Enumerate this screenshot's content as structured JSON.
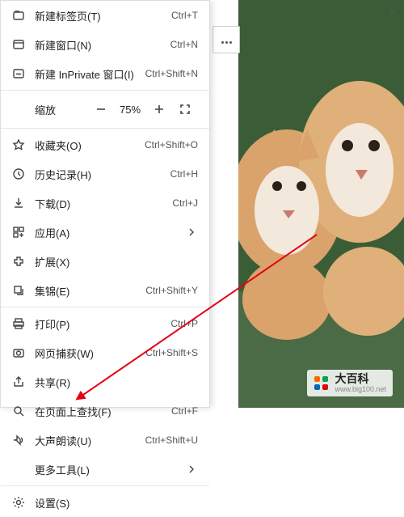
{
  "window": {
    "close": "✕"
  },
  "menu": {
    "new_tab": {
      "label": "新建标签页(T)",
      "shortcut": "Ctrl+T"
    },
    "new_window": {
      "label": "新建窗口(N)",
      "shortcut": "Ctrl+N"
    },
    "new_inprivate": {
      "label": "新建 InPrivate 窗口(I)",
      "shortcut": "Ctrl+Shift+N"
    },
    "zoom": {
      "label": "缩放",
      "value": "75%"
    },
    "favorites": {
      "label": "收藏夹(O)",
      "shortcut": "Ctrl+Shift+O"
    },
    "history": {
      "label": "历史记录(H)",
      "shortcut": "Ctrl+H"
    },
    "downloads": {
      "label": "下载(D)",
      "shortcut": "Ctrl+J"
    },
    "apps": {
      "label": "应用(A)"
    },
    "extensions": {
      "label": "扩展(X)"
    },
    "collections": {
      "label": "集锦(E)",
      "shortcut": "Ctrl+Shift+Y"
    },
    "print": {
      "label": "打印(P)",
      "shortcut": "Ctrl+P"
    },
    "capture": {
      "label": "网页捕获(W)",
      "shortcut": "Ctrl+Shift+S"
    },
    "share": {
      "label": "共享(R)"
    },
    "find": {
      "label": "在页面上查找(F)",
      "shortcut": "Ctrl+F"
    },
    "read_aloud": {
      "label": "大声朗读(U)",
      "shortcut": "Ctrl+Shift+U"
    },
    "more_tools": {
      "label": "更多工具(L)"
    },
    "settings": {
      "label": "设置(S)"
    }
  },
  "watermark": {
    "line1": "大百科",
    "line2": "www.big100.net"
  },
  "colors": {
    "accent": "#e60012",
    "bg_green": "#3a5d37"
  }
}
